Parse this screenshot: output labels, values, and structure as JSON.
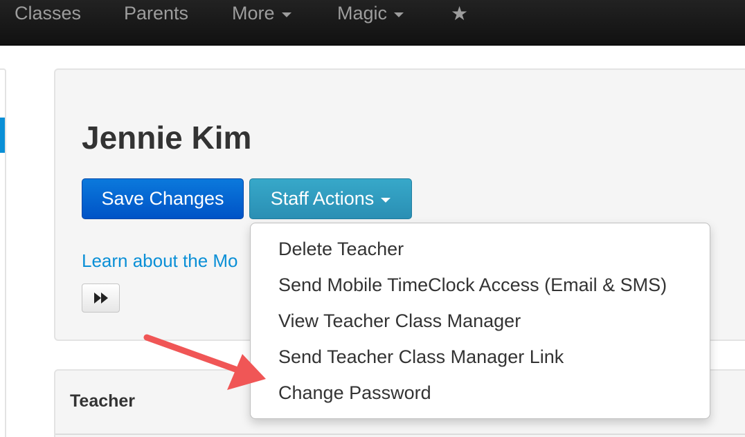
{
  "navbar": {
    "items": [
      {
        "label": "Classes"
      },
      {
        "label": "Parents"
      },
      {
        "label": "More",
        "dropdown": true
      },
      {
        "label": "Magic",
        "dropdown": true
      }
    ],
    "star_icon": "star-icon"
  },
  "page": {
    "title": "Jennie Kim",
    "save_button": "Save Changes",
    "staff_actions_button": "Staff Actions",
    "learn_link": "Learn about the Mo"
  },
  "staff_actions_menu": {
    "items": [
      {
        "label": "Delete Teacher"
      },
      {
        "label": "Send Mobile TimeClock Access (Email & SMS)"
      },
      {
        "label": "View Teacher Class Manager"
      },
      {
        "label": "Send Teacher Class Manager Link"
      },
      {
        "label": "Change Password"
      }
    ]
  },
  "teacher_panel": {
    "title": "Teacher"
  },
  "colors": {
    "navbar_bg": "#1a1a1a",
    "save_button": "#0b6fd6",
    "staff_button": "#31a0c4",
    "link": "#0a8fd6",
    "annotation_arrow": "#f05656"
  }
}
